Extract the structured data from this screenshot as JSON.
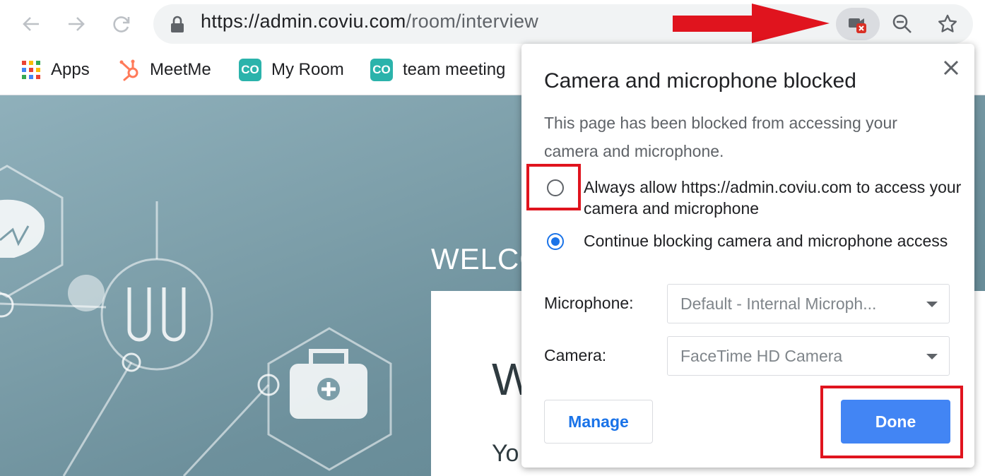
{
  "browser": {
    "url_host": "https://admin.coviu.com",
    "url_path": "/room/interview",
    "bookmarks": [
      {
        "label": "Apps",
        "icon": "apps-grid-icon"
      },
      {
        "label": "MeetMe",
        "icon": "hubspot-icon"
      },
      {
        "label": "My Room",
        "icon": "coviu-logo-icon",
        "badge": "CO"
      },
      {
        "label": "team meeting",
        "icon": "coviu-logo-icon",
        "badge": "CO"
      }
    ]
  },
  "page": {
    "banner": "WELCO",
    "card_heading": "W",
    "card_sub": "Yo"
  },
  "popup": {
    "title": "Camera and microphone blocked",
    "description": "This page has been blocked from accessing your camera and microphone.",
    "options": [
      {
        "label": "Always allow https://admin.coviu.com to access your camera and microphone",
        "selected": false
      },
      {
        "label": "Continue blocking camera and microphone access",
        "selected": true
      }
    ],
    "microphone_label": "Microphone:",
    "microphone_value": "Default - Internal Microph...",
    "camera_label": "Camera:",
    "camera_value": "FaceTime HD Camera",
    "manage_label": "Manage",
    "done_label": "Done"
  },
  "colors": {
    "accent": "#1a73e8",
    "done_button": "#4285f4",
    "annotation": "#e0141e",
    "coviu_badge": "#2bb3ab"
  }
}
